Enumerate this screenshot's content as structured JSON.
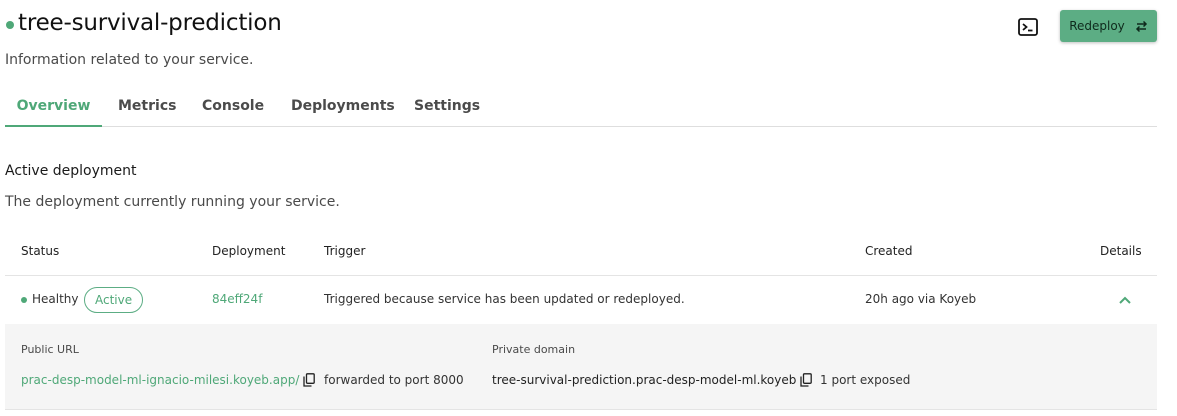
{
  "header": {
    "title": "tree-survival-prediction",
    "subtitle": "Information related to your service.",
    "redeploy_label": "Redeploy"
  },
  "tabs": [
    {
      "label": "Overview",
      "active": true
    },
    {
      "label": "Metrics"
    },
    {
      "label": "Console"
    },
    {
      "label": "Deployments"
    },
    {
      "label": "Settings"
    }
  ],
  "section": {
    "title": "Active deployment",
    "subtitle": "The deployment currently running your service."
  },
  "table": {
    "columns": [
      "Status",
      "Deployment",
      "Trigger",
      "Created",
      "Details"
    ],
    "row": {
      "status": "Healthy",
      "badge": "Active",
      "deployment": "84eff24f",
      "trigger": "Triggered because service has been updated or redeployed.",
      "created": "20h ago via Koyeb"
    }
  },
  "details": {
    "public_url_label": "Public URL",
    "public_url": "prac-desp-model-ml-ignacio-milesi.koyeb.app/",
    "public_port": "forwarded to port 8000",
    "private_domain_label": "Private domain",
    "private_domain": "tree-survival-prediction.prac-desp-model-ml.koyeb",
    "private_ports": "1 port exposed"
  },
  "colors": {
    "accent": "#4fa878",
    "button": "#5cad84",
    "details_bg": "#f5f5f5"
  },
  "icons": {
    "terminal": "terminal-icon",
    "redeploy": "redeploy-icon",
    "chevron": "chevron-up-icon",
    "copy": "copy-icon"
  }
}
